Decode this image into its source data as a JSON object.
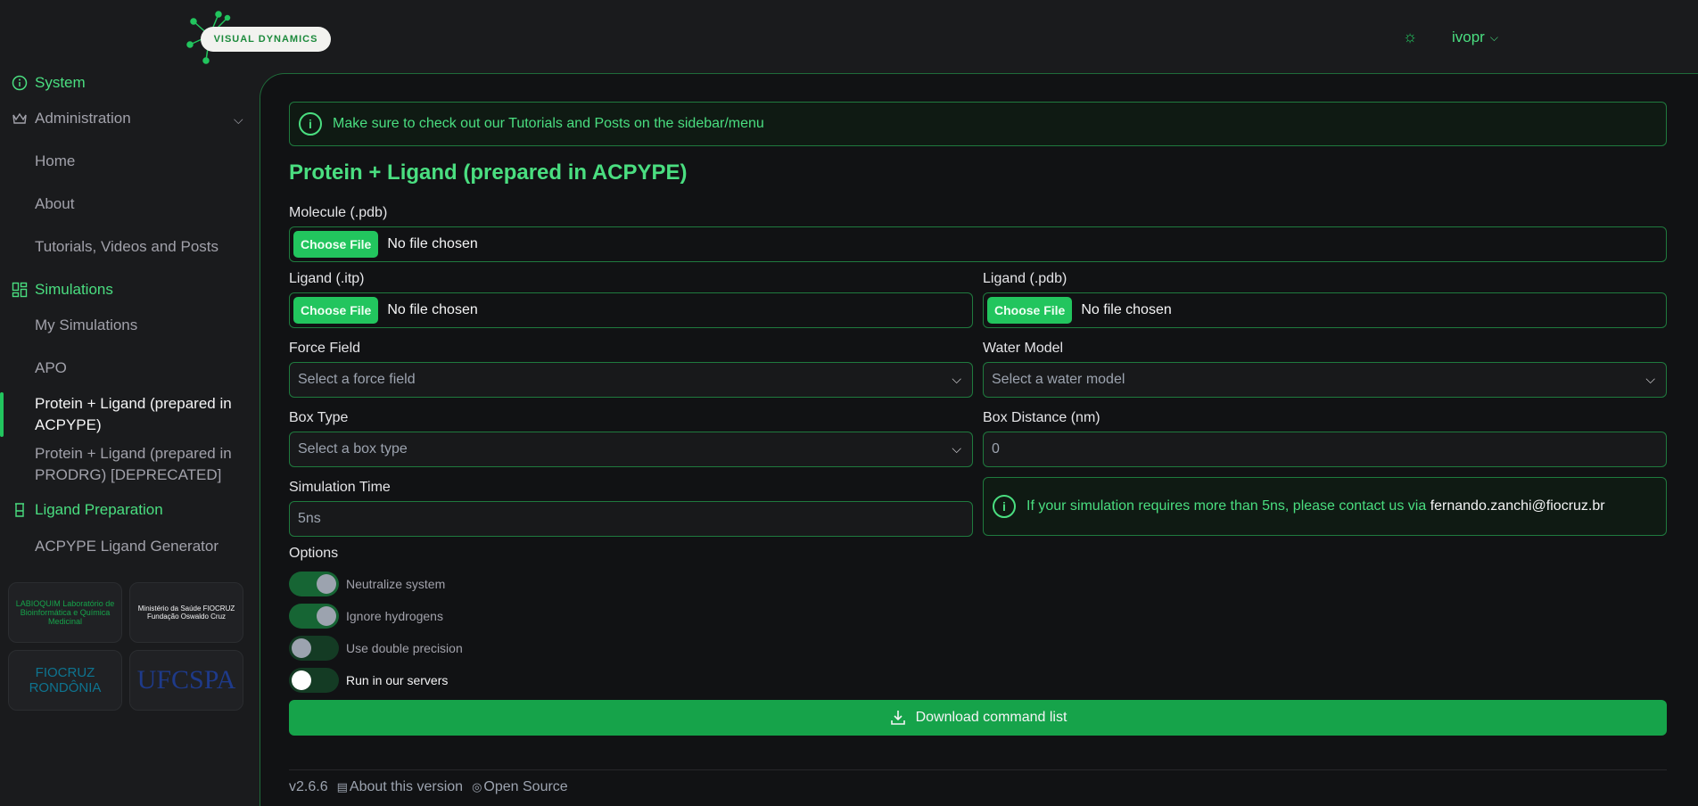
{
  "header": {
    "logo_text": "VISUAL DYNAMICS",
    "theme_icon": "sun-icon",
    "user_name": "ivopr"
  },
  "sidebar": {
    "system_label": "System",
    "administration_label": "Administration",
    "items": [
      {
        "label": "Home"
      },
      {
        "label": "About"
      },
      {
        "label": "Tutorials, Videos and Posts"
      }
    ],
    "simulations_label": "Simulations",
    "sim_items": [
      {
        "label": "My Simulations"
      },
      {
        "label": "APO"
      },
      {
        "label": "Protein + Ligand (prepared in ACPYPE)",
        "active": true
      },
      {
        "label": "Protein + Ligand (prepared in PRODRG) [DEPRECATED]"
      }
    ],
    "ligand_prep_label": "Ligand Preparation",
    "ligand_items": [
      {
        "label": "ACPYPE Ligand Generator"
      }
    ],
    "partners": {
      "labio": "LABIOQUIM Laboratório de Bioinformática e Química Medicinal",
      "ministerio": "Ministério da Saúde FIOCRUZ Fundação Oswaldo Cruz",
      "fiocruz": "FIOCRUZ RONDÔNIA",
      "ufcspa": "UFCSPA"
    }
  },
  "main": {
    "alert_text": "Make sure to check out our Tutorials and Posts on the sidebar/menu",
    "title": "Protein + Ligand (prepared in ACPYPE)",
    "molecule_label": "Molecule (.pdb)",
    "ligand_itp_label": "Ligand (.itp)",
    "ligand_pdb_label": "Ligand (.pdb)",
    "choose_file": "Choose File",
    "no_file": "No file chosen",
    "force_field_label": "Force Field",
    "force_field_placeholder": "Select a force field",
    "water_model_label": "Water Model",
    "water_model_placeholder": "Select a water model",
    "box_type_label": "Box Type",
    "box_type_placeholder": "Select a box type",
    "box_distance_label": "Box Distance (nm)",
    "box_distance_placeholder": "0",
    "sim_time_label": "Simulation Time",
    "sim_time_placeholder": "5ns",
    "info_text": "If your simulation requires more than 5ns, please contact us via",
    "info_email": "fernando.zanchi@fiocruz.br",
    "options_label": "Options",
    "options": [
      {
        "label": "Neutralize system",
        "checked": true
      },
      {
        "label": "Ignore hydrogens",
        "checked": true
      },
      {
        "label": "Use double precision",
        "checked": false
      },
      {
        "label": "Run in our servers",
        "checked": false
      }
    ],
    "download_label": "Download command list"
  },
  "footer": {
    "version": "v2.6.6",
    "about_version": "About this version",
    "open_source": "Open Source"
  }
}
